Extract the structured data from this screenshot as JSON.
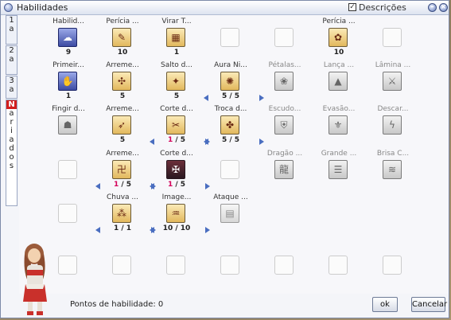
{
  "window": {
    "title": "Habilidades",
    "descriptions_checkbox": {
      "label": "Descrições",
      "checked": true
    }
  },
  "tabs": [
    {
      "label": "1a"
    },
    {
      "label": "2a"
    },
    {
      "label": "3a"
    },
    {
      "label": "Variados",
      "badge": "N",
      "active": true
    }
  ],
  "skills": [
    {
      "row": 0,
      "col": 0,
      "name": "Habilid...",
      "icon": "cloud-icon",
      "style": "blue",
      "sym": "☁",
      "level": "9"
    },
    {
      "row": 0,
      "col": 1,
      "name": "Perícia ...",
      "icon": "quill-icon",
      "style": "gold",
      "sym": "✎",
      "level": "10"
    },
    {
      "row": 0,
      "col": 2,
      "name": "Virar T...",
      "icon": "grid-icon",
      "style": "gold",
      "sym": "▦",
      "level": "1"
    },
    {
      "row": 0,
      "col": 3,
      "name": "",
      "style": "empty"
    },
    {
      "row": 0,
      "col": 4,
      "name": "",
      "style": "empty"
    },
    {
      "row": 0,
      "col": 5,
      "name": "Perícia ...",
      "icon": "flower-icon",
      "style": "gold",
      "sym": "✿",
      "level": "10"
    },
    {
      "row": 0,
      "col": 6,
      "name": "",
      "style": "empty"
    },
    {
      "row": 1,
      "col": 0,
      "name": "Primeir...",
      "icon": "hand-icon",
      "style": "blue",
      "sym": "✋",
      "level": "1"
    },
    {
      "row": 1,
      "col": 1,
      "name": "Arreme...",
      "icon": "pinwheel-icon",
      "style": "gold",
      "sym": "✣",
      "level": "5"
    },
    {
      "row": 1,
      "col": 2,
      "name": "Salto d...",
      "icon": "jump-icon",
      "style": "gold",
      "sym": "✦",
      "level": "5"
    },
    {
      "row": 1,
      "col": 3,
      "name": "Aura Ni...",
      "icon": "sparkle-icon",
      "style": "gold",
      "sym": "✺",
      "level_cur": "5",
      "level_max": "5",
      "arrows": true
    },
    {
      "row": 1,
      "col": 4,
      "name": "Pétalas...",
      "icon": "petals-icon",
      "style": "gray",
      "sym": "❀",
      "gray_name": true
    },
    {
      "row": 1,
      "col": 5,
      "name": "Lança ...",
      "icon": "spear-icon",
      "style": "gray",
      "sym": "▲",
      "gray_name": true
    },
    {
      "row": 1,
      "col": 6,
      "name": "Lâmina ...",
      "icon": "blade-icon",
      "style": "gray",
      "sym": "⚔",
      "gray_name": true
    },
    {
      "row": 2,
      "col": 0,
      "name": "Fingir d...",
      "icon": "lying-figure-icon",
      "style": "gray",
      "sym": "☗"
    },
    {
      "row": 2,
      "col": 1,
      "name": "Arreme...",
      "icon": "dagger-icon",
      "style": "gold",
      "sym": "➶",
      "level": "5"
    },
    {
      "row": 2,
      "col": 2,
      "name": "Corte d...",
      "icon": "slash-icon",
      "style": "gold",
      "sym": "✂",
      "level_cur": "1",
      "level_max": "5",
      "red": true,
      "arrows": true
    },
    {
      "row": 2,
      "col": 3,
      "name": "Troca d...",
      "icon": "swap-icon",
      "style": "gold",
      "sym": "✤",
      "level_cur": "5",
      "level_max": "5",
      "arrows": true
    },
    {
      "row": 2,
      "col": 4,
      "name": "Escudo...",
      "icon": "shield-icon",
      "style": "gray",
      "sym": "⛨",
      "gray_name": true
    },
    {
      "row": 2,
      "col": 5,
      "name": "Evasão...",
      "icon": "evasion-icon",
      "style": "gray",
      "sym": "⚜",
      "gray_name": true
    },
    {
      "row": 2,
      "col": 6,
      "name": "Descar...",
      "icon": "lightning-icon",
      "style": "gray",
      "sym": "ϟ",
      "gray_name": true
    },
    {
      "row": 3,
      "col": 0,
      "name": "",
      "style": "empty"
    },
    {
      "row": 3,
      "col": 1,
      "name": "Arreme...",
      "icon": "shuriken-icon",
      "style": "gold",
      "sym": "卍",
      "level_cur": "1",
      "level_max": "5",
      "red": true,
      "arrows": true
    },
    {
      "row": 3,
      "col": 2,
      "name": "Corte d...",
      "icon": "dark-slash-icon",
      "style": "dark",
      "sym": "✠",
      "level_cur": "1",
      "level_max": "5",
      "red": true,
      "arrows": true
    },
    {
      "row": 3,
      "col": 3,
      "name": "",
      "style": "empty"
    },
    {
      "row": 3,
      "col": 4,
      "name": "Dragão ...",
      "icon": "dragon-icon",
      "style": "gray",
      "sym": "龍",
      "gray_name": true
    },
    {
      "row": 3,
      "col": 5,
      "name": "Grande ...",
      "icon": "book-icon",
      "style": "gray",
      "sym": "☰",
      "gray_name": true
    },
    {
      "row": 3,
      "col": 6,
      "name": "Brisa C...",
      "icon": "breeze-icon",
      "style": "gray",
      "sym": "≋",
      "gray_name": true
    },
    {
      "row": 4,
      "col": 0,
      "name": "",
      "style": "empty"
    },
    {
      "row": 4,
      "col": 1,
      "name": "Chuva ...",
      "icon": "rain-icon",
      "style": "gold",
      "sym": "⁂",
      "level_cur": "1",
      "level_max": "1",
      "arrows": true
    },
    {
      "row": 4,
      "col": 2,
      "name": "Image...",
      "icon": "image-icon",
      "style": "gold",
      "sym": "♒",
      "level_cur": "10",
      "level_max": "10",
      "arrows": true
    },
    {
      "row": 4,
      "col": 3,
      "name": "Ataque ...",
      "icon": "attack-icon",
      "style": "grayframe",
      "sym": "▤"
    },
    {
      "row": 4,
      "col": 4,
      "name": "",
      "style": "none"
    },
    {
      "row": 4,
      "col": 5,
      "name": "",
      "style": "none"
    },
    {
      "row": 4,
      "col": 6,
      "name": "",
      "style": "none"
    },
    {
      "row": 5,
      "col": 0,
      "name": "",
      "style": "empty"
    },
    {
      "row": 5,
      "col": 1,
      "name": "",
      "style": "empty"
    },
    {
      "row": 5,
      "col": 2,
      "name": "",
      "style": "empty"
    },
    {
      "row": 5,
      "col": 3,
      "name": "",
      "style": "empty"
    },
    {
      "row": 5,
      "col": 4,
      "name": "",
      "style": "empty"
    },
    {
      "row": 5,
      "col": 5,
      "name": "",
      "style": "empty"
    },
    {
      "row": 5,
      "col": 6,
      "name": "",
      "style": "empty"
    }
  ],
  "footer": {
    "points_label": "Pontos de habilidade:",
    "points_value": "0",
    "ok_label": "ok",
    "cancel_label": "Cancelar"
  }
}
